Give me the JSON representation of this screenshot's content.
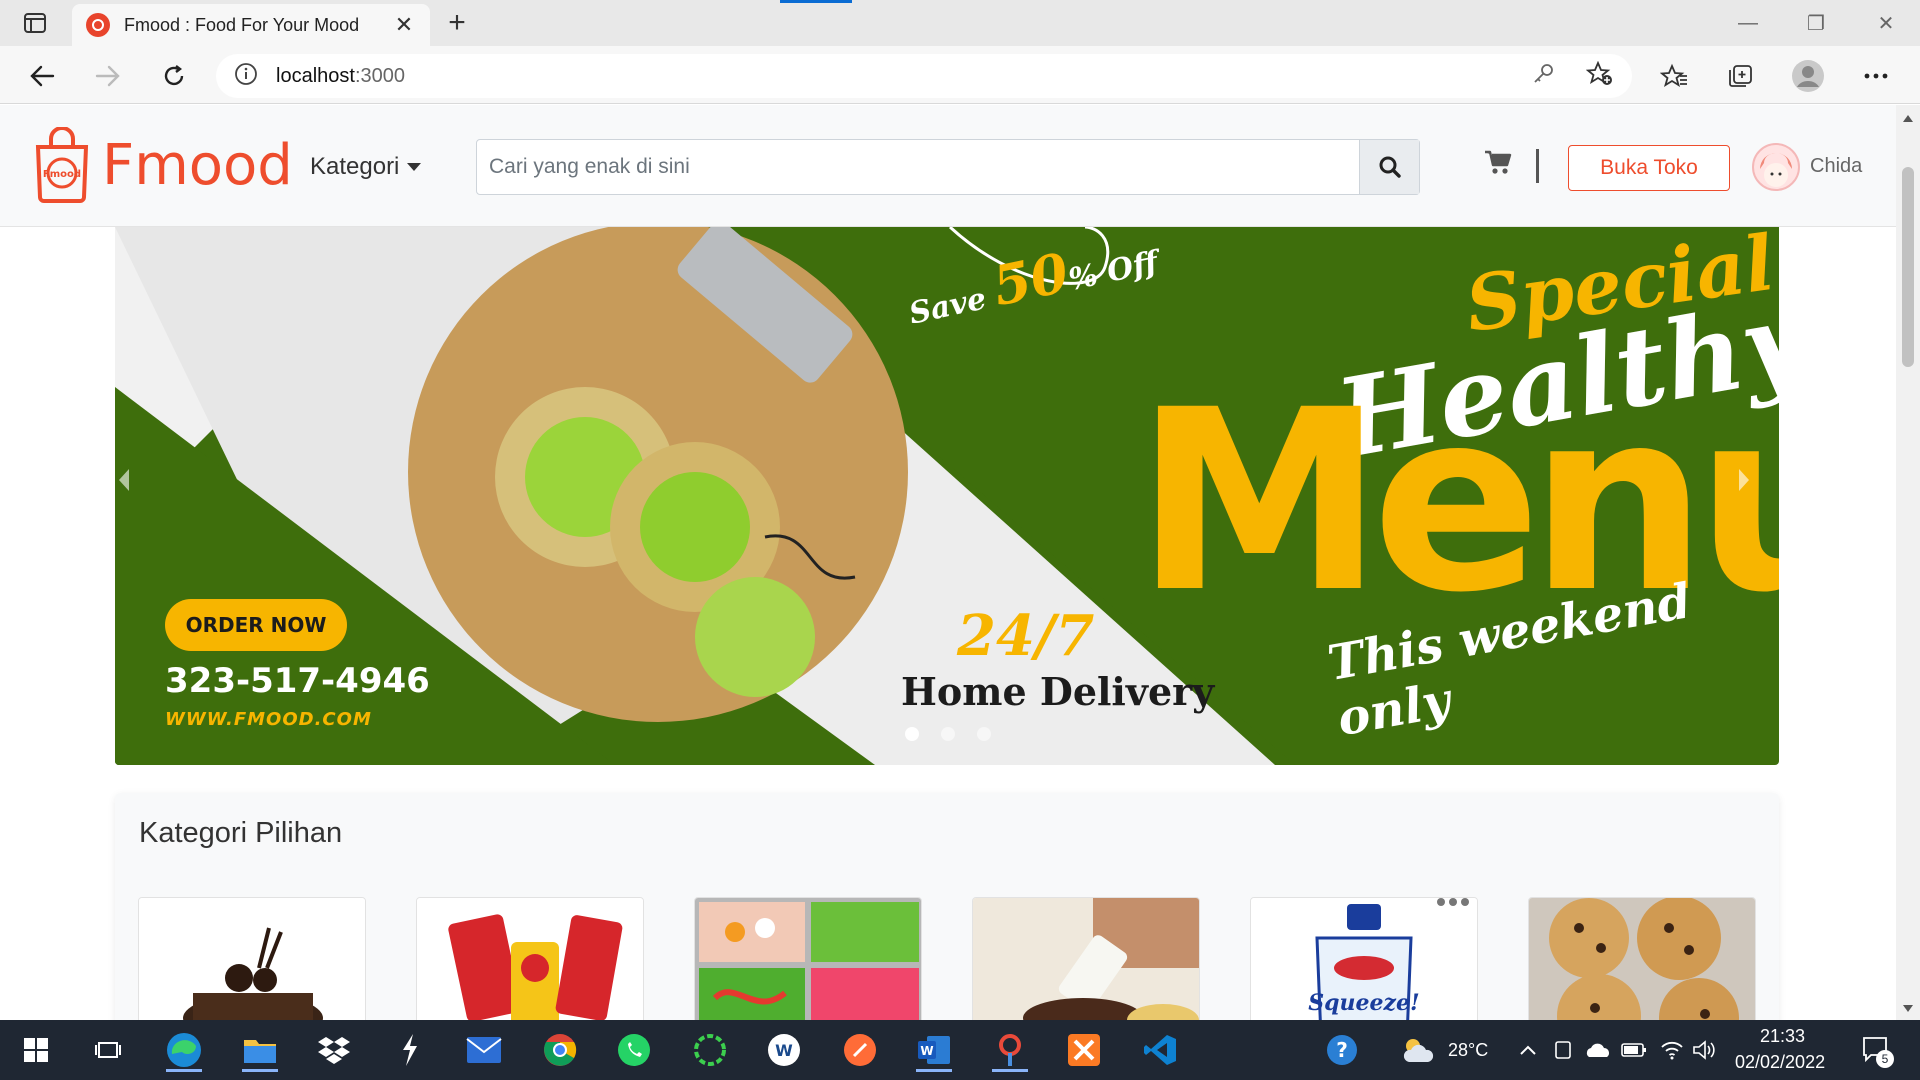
{
  "browser": {
    "tab_title": "Fmood : Food For Your Mood",
    "url_host": "localhost",
    "url_port": ":3000"
  },
  "navbar": {
    "brand": "Fmood",
    "logo_text": "Fmood",
    "category_label": "Kategori",
    "search_placeholder": "Cari yang enak di sini",
    "open_shop_label": "Buka Toko",
    "username": "Chida"
  },
  "banner": {
    "save_prefix": "Save",
    "save_value": "50",
    "save_suffix": "% Off",
    "special": "Special",
    "healthy": "Healthy",
    "menu": "Menu",
    "weekend": "This weekend only",
    "hours": "24/7",
    "delivery": "Home Delivery",
    "order_button": "ORDER NOW",
    "phone": "323-517-4946",
    "website": "WWW.FMOOD.COM",
    "active_slide": 1,
    "slide_count": 3
  },
  "categories": {
    "title": "Kategori Pilihan",
    "items": [
      {
        "name": "cake-category",
        "picture": "chocolate cake"
      },
      {
        "name": "chips-category",
        "picture": "potato chips bags"
      },
      {
        "name": "candy-category",
        "picture": "gummy candy trays"
      },
      {
        "name": "drink-category",
        "picture": "milk pouring"
      },
      {
        "name": "yogurt-category",
        "picture": "Cimory Squeeze yogurt"
      },
      {
        "name": "cookie-category",
        "picture": "chocolate chip cookies"
      }
    ],
    "product_label": "Squeeze!"
  },
  "taskbar": {
    "weather": "28°C",
    "time": "21:33",
    "date": "02/02/2022",
    "notifications": "5"
  },
  "colors": {
    "brand": "#ee4d2d",
    "banner_green": "#3c6e0a",
    "banner_yellow": "#f7b500",
    "taskbar": "#1f2733"
  }
}
